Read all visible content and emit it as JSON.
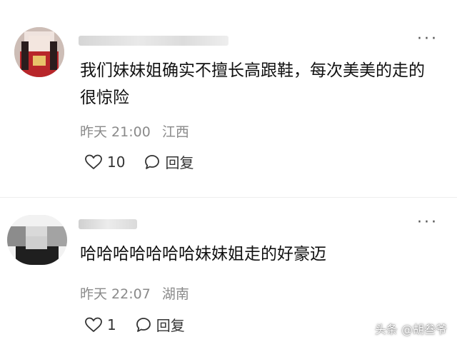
{
  "comments": [
    {
      "text": "我们妹妹姐确实不擅长高跟鞋，每次美美的走的很惊险",
      "time": "昨天 21:00",
      "location": "江西",
      "likes": "10",
      "reply_label": "回复"
    },
    {
      "text": "哈哈哈哈哈哈哈妹妹姐走的好豪迈",
      "time": "昨天 22:07",
      "location": "湖南",
      "likes": "1",
      "reply_label": "回复"
    }
  ],
  "more_label": "···",
  "watermark": "头条 @胡叁爷",
  "icons": {
    "like": "heart-icon",
    "reply": "speech-bubble-icon",
    "more": "more-dots-icon"
  }
}
